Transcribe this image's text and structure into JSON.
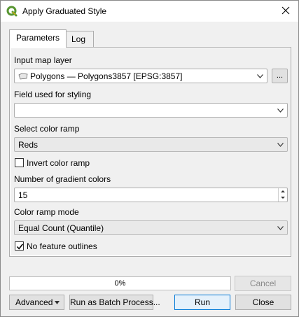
{
  "window": {
    "title": "Apply Graduated Style",
    "close_icon": "close-icon",
    "app_icon": "qgis-logo-icon"
  },
  "tabs": [
    {
      "label": "Parameters",
      "active": true
    },
    {
      "label": "Log",
      "active": false
    }
  ],
  "form": {
    "input_layer": {
      "label": "Input map layer",
      "value": "Polygons — Polygons3857 [EPSG:3857]",
      "icon": "polygon-layer-icon",
      "browse_label": "..."
    },
    "field": {
      "label": "Field used for styling",
      "value": ""
    },
    "color_ramp": {
      "label": "Select color ramp",
      "value": "Reds"
    },
    "invert": {
      "label": "Invert color ramp",
      "checked": false
    },
    "gradient_colors": {
      "label": "Number of gradient colors",
      "value": "15"
    },
    "ramp_mode": {
      "label": "Color ramp mode",
      "value": "Equal Count (Quantile)"
    },
    "no_outlines": {
      "label": "No feature outlines",
      "checked": true
    }
  },
  "progress": {
    "text": "0%",
    "value": 0
  },
  "buttons": {
    "cancel": "Cancel",
    "advanced": "Advanced",
    "batch": "Run as Batch Process...",
    "run": "Run",
    "close": "Close"
  },
  "colors": {
    "accent": "#0078d7",
    "progress_fill": "#06b025",
    "qgis_green": "#589632"
  }
}
